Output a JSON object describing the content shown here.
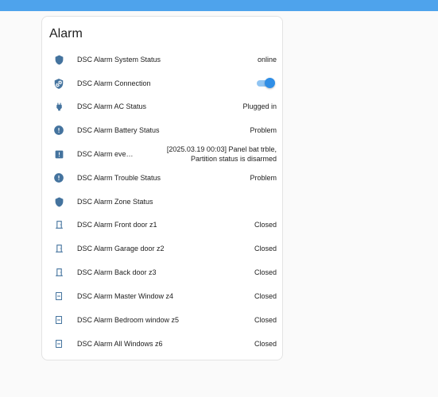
{
  "card": {
    "title": "Alarm",
    "rows": [
      {
        "name": "DSC Alarm System Status",
        "state": "online",
        "icon": "shield-icon"
      },
      {
        "name": "DSC Alarm Connection",
        "state": "",
        "icon": "shield-link-icon",
        "toggle_on": true
      },
      {
        "name": "DSC Alarm AC Status",
        "state": "Plugged in",
        "icon": "power-plug-icon"
      },
      {
        "name": "DSC Alarm Battery Status",
        "state": "Problem",
        "icon": "alert-circle-icon"
      },
      {
        "name": "DSC Alarm eve…",
        "state": "[2025.03.19 00:03] Panel bat trble, Partition status is disarmed",
        "icon": "alert-box-icon"
      },
      {
        "name": "DSC Alarm Trouble Status",
        "state": "Problem",
        "icon": "alert-circle-icon"
      },
      {
        "name": "DSC Alarm Zone Status",
        "state": "",
        "icon": "shield-icon"
      },
      {
        "name": "DSC Alarm Front door z1",
        "state": "Closed",
        "icon": "door-closed-icon"
      },
      {
        "name": "DSC Alarm Garage door z2",
        "state": "Closed",
        "icon": "door-closed-icon"
      },
      {
        "name": "DSC Alarm Back door z3",
        "state": "Closed",
        "icon": "door-closed-icon"
      },
      {
        "name": "DSC Alarm Master Window z4",
        "state": "Closed",
        "icon": "window-closed-icon"
      },
      {
        "name": "DSC Alarm Bedroom window z5",
        "state": "Closed",
        "icon": "window-closed-icon"
      },
      {
        "name": "DSC Alarm All Windows z6",
        "state": "Closed",
        "icon": "window-closed-icon"
      }
    ]
  },
  "colors": {
    "header": "#4ea3ec",
    "icon": "#44739e",
    "toggle_thumb": "#2f8ee6",
    "toggle_track": "#90c4f2"
  }
}
